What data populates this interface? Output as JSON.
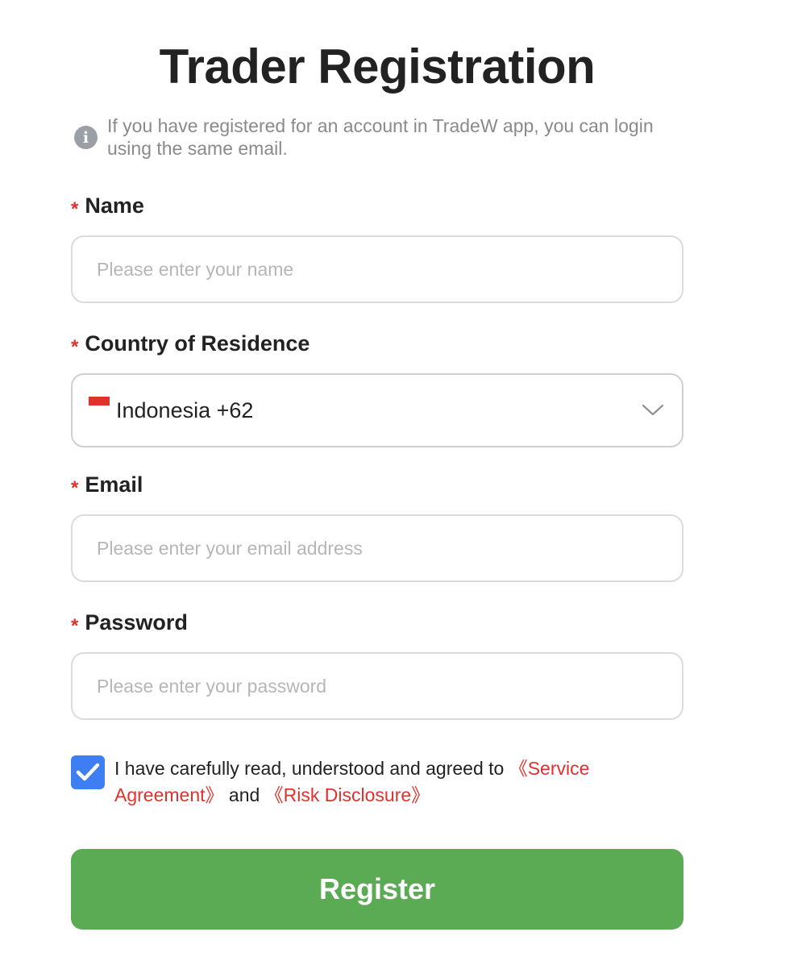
{
  "page": {
    "title": "Trader Registration",
    "notice": "If you have registered for an account in TradeW app, you can login using the same email.",
    "notice_icon": "info-icon"
  },
  "form": {
    "required_marker": "*",
    "name": {
      "label": "Name",
      "placeholder": "Please enter your name",
      "value": ""
    },
    "country": {
      "label": "Country of Residence",
      "value": "Indonesia +62",
      "flag_icon": "indonesia-flag-icon",
      "dropdown_icon": "chevron-down-icon"
    },
    "email": {
      "label": "Email",
      "placeholder": "Please enter your email address",
      "value": ""
    },
    "password": {
      "label": "Password",
      "placeholder": "Please enter your password",
      "value": ""
    },
    "agreement": {
      "checked": true,
      "text_before": "I have carefully read, understood and agreed to ",
      "service_link": "《Service Agreement》",
      "conjunction": " and ",
      "risk_link": "《Risk Disclosure》"
    },
    "submit_label": "Register"
  },
  "colors": {
    "accent_green": "#5bab55",
    "required_red": "#e0322d",
    "link_red": "#e0322d",
    "checkbox_blue": "#3d7ff2",
    "flag_red": "#e0322d"
  }
}
